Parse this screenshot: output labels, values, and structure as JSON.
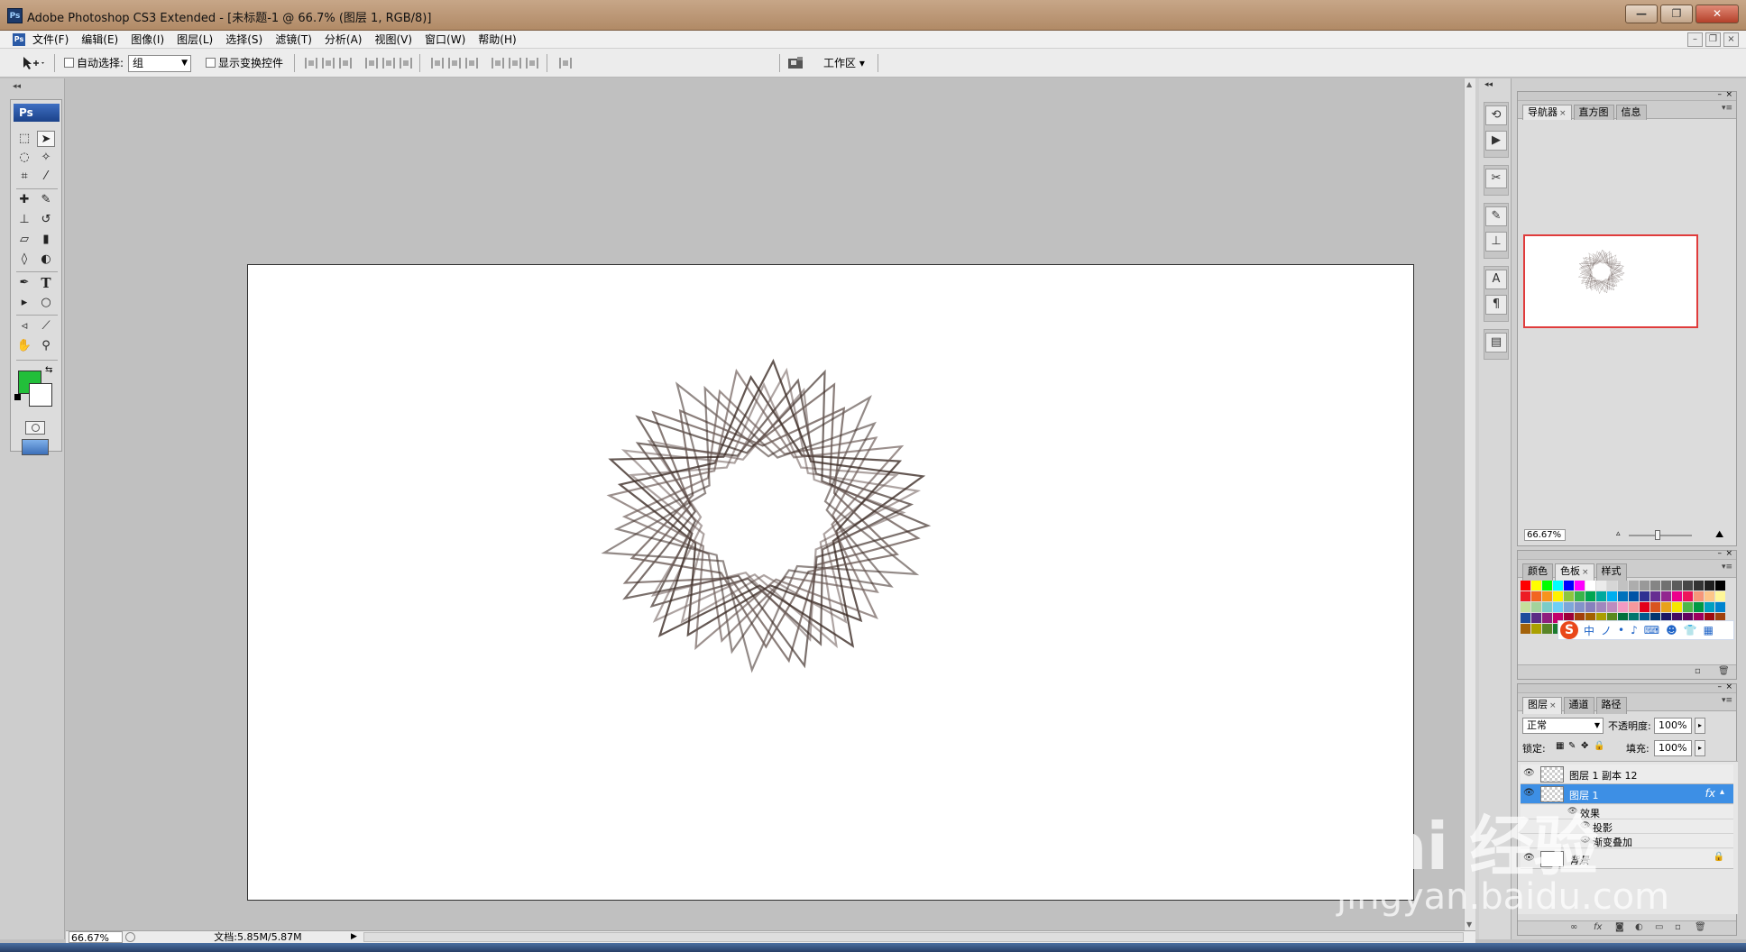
{
  "window": {
    "title": "Adobe Photoshop CS3 Extended - [未标题-1 @ 66.7% (图层 1, RGB/8)]",
    "app_icon": "Ps",
    "controls": [
      "—",
      "❐",
      "✕"
    ]
  },
  "menubar": {
    "items": [
      "文件(F)",
      "编辑(E)",
      "图像(I)",
      "图层(L)",
      "选择(S)",
      "滤镜(T)",
      "分析(A)",
      "视图(V)",
      "窗口(W)",
      "帮助(H)"
    ],
    "doc_controls": [
      "–",
      "❐",
      "×"
    ]
  },
  "optionsbar": {
    "auto_select_label": "自动选择:",
    "auto_select_value": "组",
    "show_transform_label": "显示变换控件",
    "workspace_label": "工作区 ▾"
  },
  "toolbox": {
    "logo": "Ps",
    "foreground_color": "#22bf3a",
    "background_color": "#ffffff",
    "tools": [
      "marquee",
      "move",
      "lasso",
      "magic-wand",
      "crop",
      "slice",
      "healing",
      "brush",
      "clone-stamp",
      "history-brush",
      "eraser",
      "gradient",
      "blur",
      "dodge",
      "pen",
      "type",
      "path-select",
      "shape",
      "notes",
      "eyedropper",
      "hand",
      "zoom"
    ],
    "type_tool_glyph": "T"
  },
  "canvas": {
    "background": "#ffffff",
    "artwork": "spirograph star pattern"
  },
  "statusbar": {
    "zoom": "66.67%",
    "doc_size": "文档:5.85M/5.87M"
  },
  "navigator": {
    "tabs": [
      "导航器",
      "直方图",
      "信息"
    ],
    "zoom": "66.67%",
    "view_box_color": "#e03c3c"
  },
  "swatches": {
    "tabs": [
      "颜色",
      "色板",
      "样式"
    ],
    "colors": [
      "#ff0000",
      "#ffff00",
      "#00ff00",
      "#00ffff",
      "#0000ff",
      "#ff00ff",
      "#ffffff",
      "#ebebeb",
      "#d6d6d6",
      "#c2c2c2",
      "#adadad",
      "#999999",
      "#858585",
      "#707070",
      "#5c5c5c",
      "#474747",
      "#333333",
      "#1f1f1f",
      "#000000",
      "#ed1c24",
      "#f26522",
      "#f7941d",
      "#fff200",
      "#8dc63f",
      "#39b54a",
      "#00a651",
      "#00a99d",
      "#00aeef",
      "#0072bc",
      "#0054a6",
      "#2e3192",
      "#662d91",
      "#92278f",
      "#ec008c",
      "#ed145b",
      "#f69679",
      "#fdc689",
      "#fff799",
      "#c4df9b",
      "#a3d39c",
      "#7accc8",
      "#6dcff6",
      "#7da7d9",
      "#8393ca",
      "#8781bd",
      "#a187be",
      "#bd8cbf",
      "#f49ac2",
      "#f5989d",
      "#e2001a",
      "#d9541e",
      "#e8a21b",
      "#f6e500",
      "#4db849",
      "#009944",
      "#00a0c1",
      "#0084cf",
      "#1d4c9c",
      "#5b2d85",
      "#8f1f7e",
      "#c2006b",
      "#9e0039",
      "#a3400b",
      "#a36100",
      "#ab9e00",
      "#5a8a1e",
      "#00713d",
      "#00776e",
      "#005b8f",
      "#00366f",
      "#1b1464",
      "#440e62",
      "#630460",
      "#9e005d",
      "#9e0b0f",
      "#a0410d",
      "#a3620a",
      "#aba000",
      "#598527",
      "#1a7b30",
      "#007236",
      "#00746b",
      "#0076a3",
      "#004b80",
      "#003471",
      "#1b1464",
      "#440e62",
      "#630460",
      "#9e005d",
      "#9e0b0f",
      "#7b5c3f",
      "#a67c52",
      "#c69c6d",
      "#8c6239",
      "#603913"
    ],
    "ime_glyphs": [
      "中",
      "ノ",
      "•",
      "♪",
      "⌨",
      "☻",
      "👕",
      "▦"
    ],
    "ime_logo": "S"
  },
  "layers": {
    "tabs": [
      "图层",
      "通道",
      "路径"
    ],
    "blend_mode": "正常",
    "opacity_label": "不透明度:",
    "opacity_value": "100%",
    "lock_label": "锁定:",
    "fill_label": "填充:",
    "fill_value": "100%",
    "items": [
      {
        "name": "图层 1 副本 12",
        "active": false
      },
      {
        "name": "图层 1",
        "active": true,
        "fx": "fx"
      },
      {
        "name": "背景",
        "active": false,
        "locked": true
      }
    ],
    "effects_header": "效果",
    "effects": [
      "投影",
      "渐变叠加"
    ]
  },
  "watermark": {
    "line1": "Bai 经验",
    "line2": "jingyan.baidu.com"
  }
}
